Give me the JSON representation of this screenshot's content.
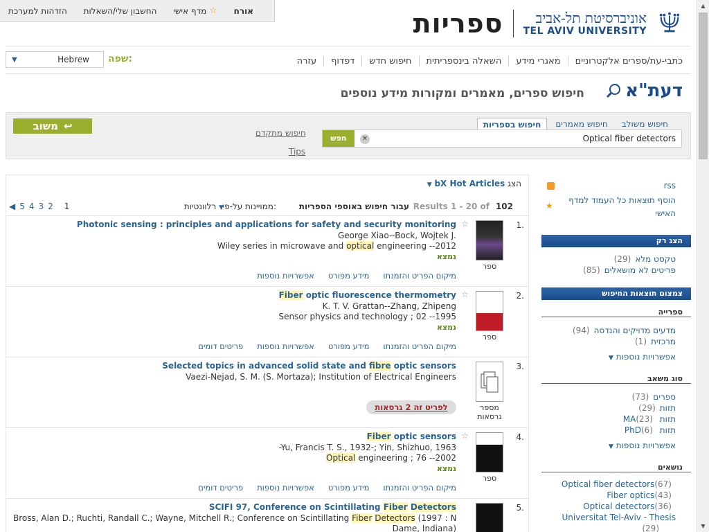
{
  "userbar": {
    "guest": "אורח",
    "personal_shelf": "מדף אישי",
    "account": "החשבון שלי/השאלות",
    "login": "הזדהות למערכת"
  },
  "brand": {
    "university_he": "אוניברסיטת תל-אביב",
    "university_en": "TEL AVIV UNIVERSITY",
    "libraries": "ספריות",
    "color": "#1b4c8c"
  },
  "nav": {
    "items": [
      "כתבי-עת/ספרים אלקטרוניים",
      "מאגרי מידע",
      "השאלה בינספריתית",
      "חיפוש חדש",
      "דפדוף",
      "עזרה"
    ],
    "language_label": "שפה:",
    "language_value": "Hebrew"
  },
  "daat": {
    "logo": "דעת\"א",
    "subtitle": "חיפוש ספרים, מאמרים ומקורות מידע נוספים"
  },
  "search": {
    "tabs": [
      "חיפוש משולב",
      "חיפוש מאמרים",
      "חיפוש בספריות"
    ],
    "active_tab": "חיפוש בספריות",
    "query": "Optical fiber detectors",
    "go": "חפש",
    "advanced": "חיפוש מתקדם",
    "tips": "Tips",
    "feedback": "משוב",
    "accent": "#9cae2e"
  },
  "results": {
    "show_label": "הצג",
    "bx": "bX Hot Articles",
    "count": "102",
    "range": "Results 1 - 20 of",
    "scope": "עבור חיפוש באוספי הספריות",
    "sort_label": "ממויינות על-פי:",
    "sort_value": "רלוונטיות",
    "pages": [
      "1",
      "2",
      "3",
      "4",
      "5"
    ],
    "items": [
      {
        "num": "1.",
        "title": "Photonic sensing : principles and applications for safety and security monitoring",
        "authors": "George Xiao--Bock, Wojtek J.",
        "series": "Wiley series in microwave and optical engineering --2012",
        "avail": "נמצא",
        "type": "ספר",
        "links": [
          "מיקום הפריט והזמנתו",
          "מידע מפורט",
          "אפשרויות נוספות"
        ]
      },
      {
        "num": "2.",
        "title": "Fiber optic fluorescence thermometry",
        "authors": "K. T. V. Grattan--Zhang, Zhipeng",
        "series": "Sensor physics and technology ; 02 --1995",
        "avail": "נמצא",
        "type": "ספר",
        "links": [
          "מיקום הפריט והזמנתו",
          "מידע מפורט",
          "אפשרויות נוספות",
          "פריטים דומים"
        ]
      },
      {
        "num": "3.",
        "title": "Selected topics in advanced solid state and fibre optic sensors",
        "authors": "Vaezi-Nejad, S. M. (S. Mortaza); Institution of Electrical Engineers",
        "versions": "לפריט זה 2 גרסאות",
        "type": "מספר גרסאות"
      },
      {
        "num": "4.",
        "title": "Fiber optic sensors",
        "authors": "-Yu, Francis T. S., 1932-; Yin, Shizhuo, 1963",
        "series": "Optical engineering ; 76 --2002",
        "avail": "נמצא",
        "type": "ספר",
        "links": [
          "מיקום הפריט והזמנתו",
          "מידע מפורט",
          "אפשרויות נוספות",
          "פריטים דומים"
        ]
      },
      {
        "num": "5.",
        "title": "SCIFI 97, Conference on Scintillating Fiber Detectors",
        "authors": "Bross, Alan D.; Ruchti, Randall C.; Wayne, Mitchell R.; Conference on Scintillating Fiber Detectors (1997 : Notre",
        "series": "Dame, Indiana)"
      }
    ]
  },
  "sidebar": {
    "rss": "rss",
    "add_all_1": "הוסף תוצאות כל העמוד למדף",
    "add_all_2": "האישי",
    "show_only": "הצג רק",
    "full_text": "טקסט מלא",
    "full_text_count": "(29)",
    "not_borrowed": "פריטים לא מושאלים",
    "not_borrowed_count": "(85)",
    "refine": "צמצום תוצאות החיפוש",
    "library_section": "ספרייה",
    "lib1": "מדעים מדויקים והנדסה",
    "lib1_count": "(94)",
    "lib2": "מרכזית",
    "lib2_count": "(1)",
    "more1": "אפשרויות נוספות",
    "type_section": "סוג משאב",
    "t1": "ספרים",
    "t1c": "(73)",
    "t2": "תזות",
    "t2c": "(29)",
    "t3": "תזות MA",
    "t3c": "(23)",
    "t4": "תזות PhD",
    "t4c": "(6)",
    "more2": "אפשרויות נוספות",
    "topics_section": "נושאים",
    "s1": "Optical fiber detectors",
    "s1c": "(67)",
    "s2": "Fiber optics",
    "s2c": "(43)",
    "s3": "Optical detectors",
    "s3c": "(36)",
    "s4": "Universitat Tel-Aviv - Thesis",
    "s4c": "(29)"
  }
}
